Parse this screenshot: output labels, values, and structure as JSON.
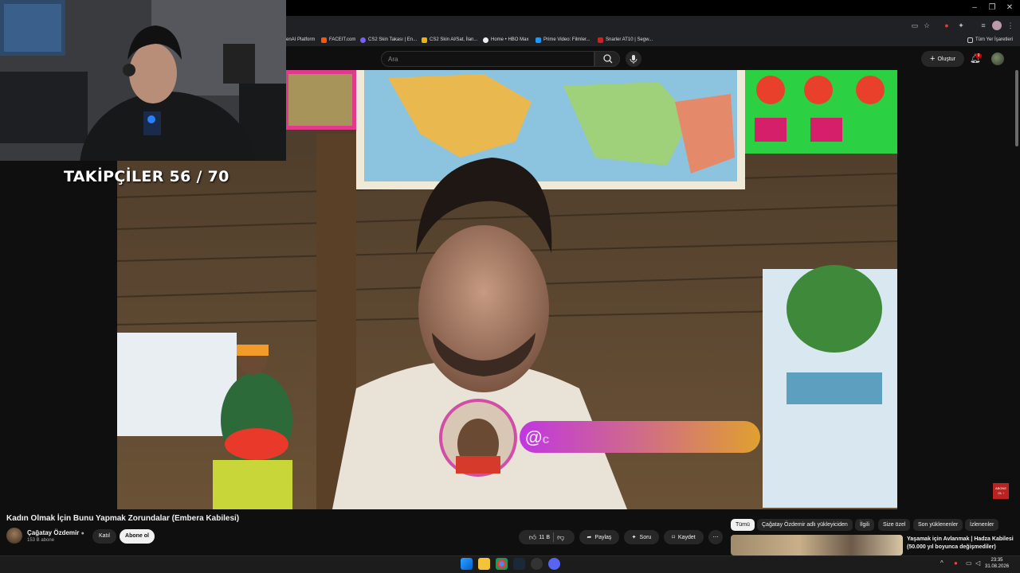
{
  "browser": {
    "bookmarks": [
      {
        "label": "enAI Platform",
        "color": "#666666"
      },
      {
        "label": "FACEIT.com",
        "color": "#ff5500"
      },
      {
        "label": "CS2 Skin Takası | En...",
        "color": "#7b5cff"
      },
      {
        "label": "CS2 Skin Al/Sat, İlan...",
        "color": "#f0b400"
      },
      {
        "label": "Home • HBO Max",
        "color": "#ffffff"
      },
      {
        "label": "Prime Video: Filmler...",
        "color": "#1a98ff"
      },
      {
        "label": "Snarler AT10 | Segw...",
        "color": "#cc2222"
      }
    ],
    "all_bookmarks_label": "Tüm Yer İşaretleri"
  },
  "header": {
    "search_placeholder": "Ara",
    "create_label": "Oluştur",
    "notification_count": "9"
  },
  "stream_overlay": {
    "followers_label": "TAKİPÇİLER 56 / 70",
    "handle_prefix": "@",
    "handle_fragment": "c",
    "mini_logo_text": "ABONE OL !"
  },
  "video": {
    "title": "Kadın Olmak İçin Bunu Yapmak Zorundalar (Embera Kabilesi)",
    "channel_name": "Çağatay Özdemir",
    "subscribers": "153 B abone",
    "join_label": "Katıl",
    "subscribe_label": "Abone ol",
    "likes": "11 B",
    "share_label": "Paylaş",
    "ask_label": "Soru",
    "save_label": "Kaydet"
  },
  "chips": [
    "Tümü",
    "Çağatay Özdemir adlı yükleyiciden",
    "İlgili",
    "Size özel",
    "Son yüklenenler",
    "İzlenenler"
  ],
  "recommendation": {
    "title": "Yaşamak için Avlanmak | Hadza Kabilesi (50.000 yıl boyunca değişmediler)"
  },
  "taskbar": {
    "time": "23:35",
    "date": "31.08.2026"
  },
  "colors": {
    "youtube_bg": "#0f0f0f",
    "pill_bg": "#272727",
    "badge_red": "#cc0000",
    "handle_gradient_start": "#c037e0",
    "handle_gradient_end": "#e0a030"
  }
}
